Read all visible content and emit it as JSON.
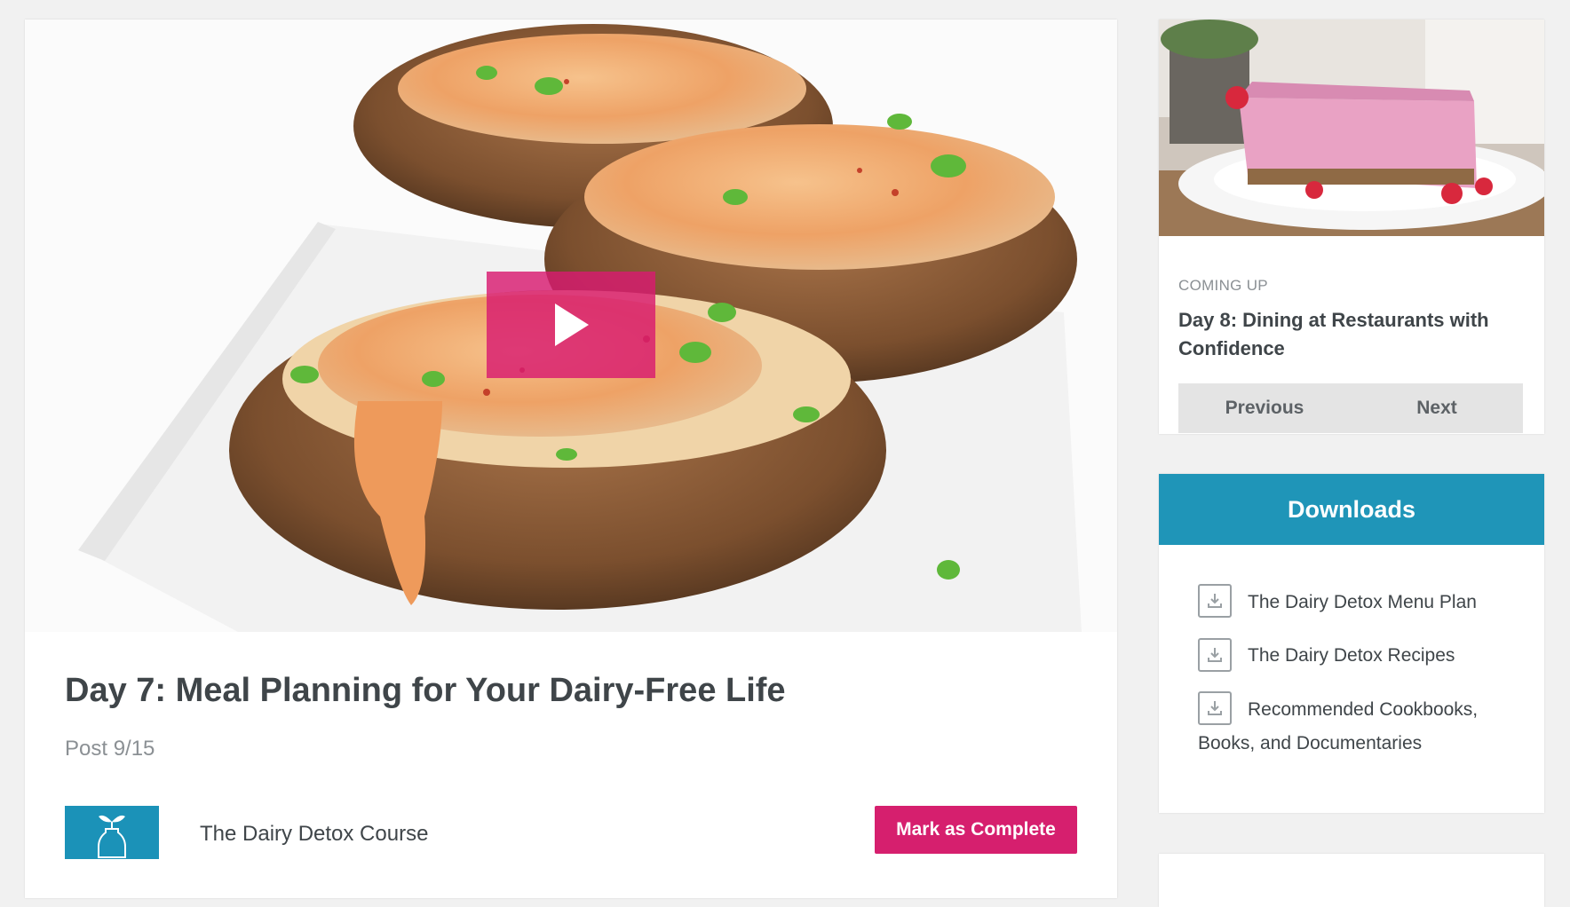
{
  "lesson": {
    "title": "Day 7: Meal Planning for Your Dairy-Free Life",
    "post_label": "Post 9/15",
    "course_name": "The Dairy Detox Course",
    "complete_button": "Mark as Complete",
    "play_icon": "play-icon"
  },
  "coming_up": {
    "label": "COMING UP",
    "title": "Day 8: Dining at Restaurants with Confidence",
    "previous_button": "Previous",
    "next_button": "Next"
  },
  "downloads": {
    "header": "Downloads",
    "icon": "download-icon",
    "items": [
      {
        "label": "The Dairy Detox Menu Plan"
      },
      {
        "label": "The Dairy Detox Recipes"
      },
      {
        "label": "Recommended Cookbooks, Books, and Documentaries"
      }
    ]
  },
  "colors": {
    "accent_pink": "#d61f6e",
    "accent_teal": "#1f95b8",
    "background": "#f1f1f1"
  }
}
